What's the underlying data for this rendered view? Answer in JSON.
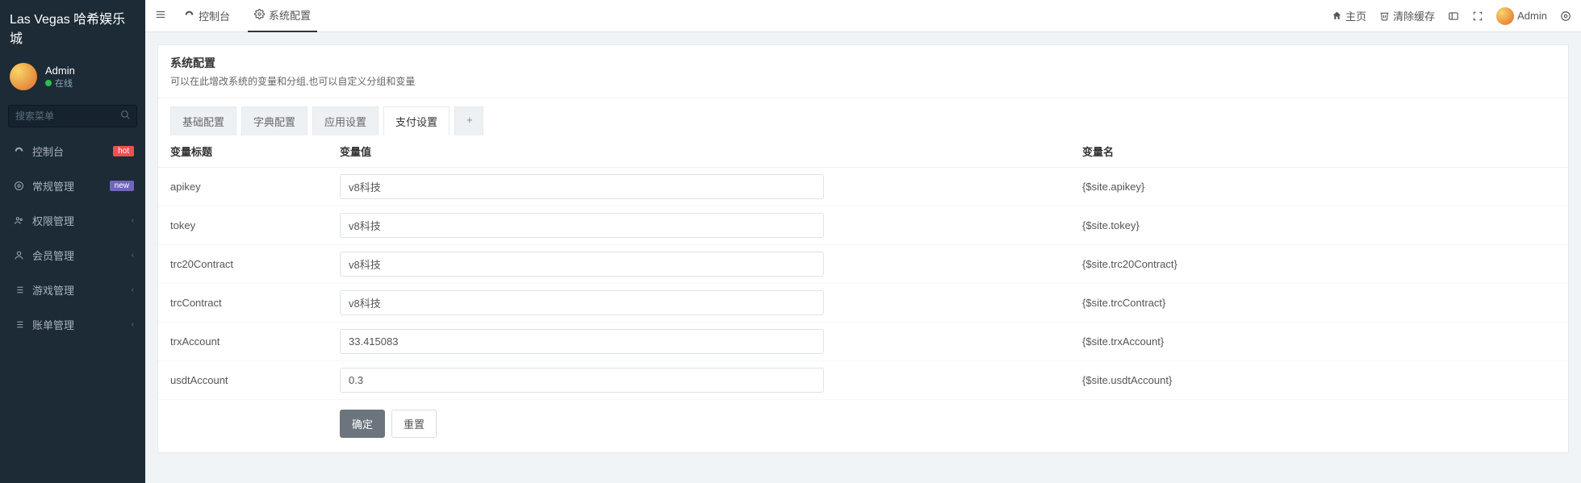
{
  "brand": "Las Vegas 哈希娱乐城",
  "user": {
    "name": "Admin",
    "status": "在线"
  },
  "search": {
    "placeholder": "搜索菜单"
  },
  "nav": [
    {
      "icon": "dashboard",
      "label": "控制台",
      "badge": "hot",
      "badgeClass": "badge-hot",
      "chev": false
    },
    {
      "icon": "cogs",
      "label": "常规管理",
      "badge": "new",
      "badgeClass": "badge-new",
      "chev": false
    },
    {
      "icon": "group",
      "label": "权限管理",
      "badge": "",
      "badgeClass": "",
      "chev": true
    },
    {
      "icon": "user",
      "label": "会员管理",
      "badge": "",
      "badgeClass": "",
      "chev": true
    },
    {
      "icon": "list",
      "label": "游戏管理",
      "badge": "",
      "badgeClass": "",
      "chev": true
    },
    {
      "icon": "list",
      "label": "账单管理",
      "badge": "",
      "badgeClass": "",
      "chev": true
    }
  ],
  "topbar": {
    "tab1": "控制台",
    "tab2": "系统配置",
    "home": "主页",
    "clear": "清除缓存",
    "admin": "Admin"
  },
  "panel": {
    "title": "系统配置",
    "desc": "可以在此增改系统的变量和分组,也可以自定义分组和变量"
  },
  "tabs": {
    "t1": "基础配置",
    "t2": "字典配置",
    "t3": "应用设置",
    "t4": "支付设置",
    "plus": "+"
  },
  "headers": {
    "title": "变量标题",
    "value": "变量值",
    "name": "变量名"
  },
  "rows": [
    {
      "title": "apikey",
      "value": "v8科技",
      "name": "{$site.apikey}"
    },
    {
      "title": "tokey",
      "value": "v8科技",
      "name": "{$site.tokey}"
    },
    {
      "title": "trc20Contract",
      "value": "v8科技",
      "name": "{$site.trc20Contract}"
    },
    {
      "title": "trcContract",
      "value": "v8科技",
      "name": "{$site.trcContract}"
    },
    {
      "title": "trxAccount",
      "value": "33.415083",
      "name": "{$site.trxAccount}"
    },
    {
      "title": "usdtAccount",
      "value": "0.3",
      "name": "{$site.usdtAccount}"
    }
  ],
  "buttons": {
    "ok": "确定",
    "reset": "重置"
  }
}
